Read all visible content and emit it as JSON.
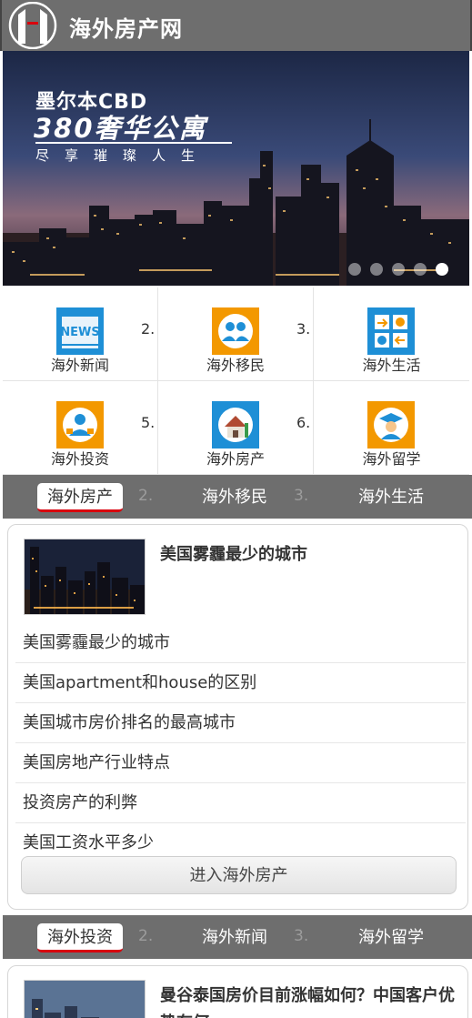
{
  "header": {
    "site_title": "海外房产网"
  },
  "banner": {
    "line1": "墨尔本CBD",
    "line2": "380奢华公寓",
    "line3": "尽享璀璨人生",
    "slide_count": 5,
    "active_slide": 5
  },
  "categories": [
    {
      "label": "海外新闻",
      "icon": "news-icon",
      "index": "2."
    },
    {
      "label": "海外移民",
      "icon": "immigration-icon",
      "index": "3."
    },
    {
      "label": "海外生活",
      "icon": "life-icon",
      "index": ""
    },
    {
      "label": "海外投资",
      "icon": "investment-icon",
      "index": "5."
    },
    {
      "label": "海外房产",
      "icon": "house-icon",
      "index": "6."
    },
    {
      "label": "海外留学",
      "icon": "graduation-icon",
      "index": ""
    }
  ],
  "section1": {
    "tabs": [
      {
        "label": "海外房产",
        "active": true
      },
      {
        "label": "海外移民",
        "active": false
      },
      {
        "label": "海外生活",
        "active": false
      }
    ],
    "tab_numbers": [
      "2.",
      "3."
    ],
    "featured_title": "美国雾霾最少的城市",
    "items": [
      "美国雾霾最少的城市",
      "美国apartment和house的区别",
      "美国城市房价排名的最高城市",
      "美国房地产行业特点",
      "投资房产的利弊",
      "美国工资水平多少"
    ],
    "enter_label": "进入海外房产"
  },
  "section2": {
    "tabs": [
      {
        "label": "海外投资",
        "active": true
      },
      {
        "label": "海外新闻",
        "active": false
      },
      {
        "label": "海外留学",
        "active": false
      }
    ],
    "tab_numbers": [
      "2.",
      "3."
    ],
    "featured_title": "曼谷泰国房价目前涨幅如何？中国客户优势有何"
  },
  "colors": {
    "header_bg": "#6e6e6e",
    "tab_underline": "#d9000d",
    "icon_orange": "#f39800",
    "icon_blue": "#1e8fd6"
  }
}
